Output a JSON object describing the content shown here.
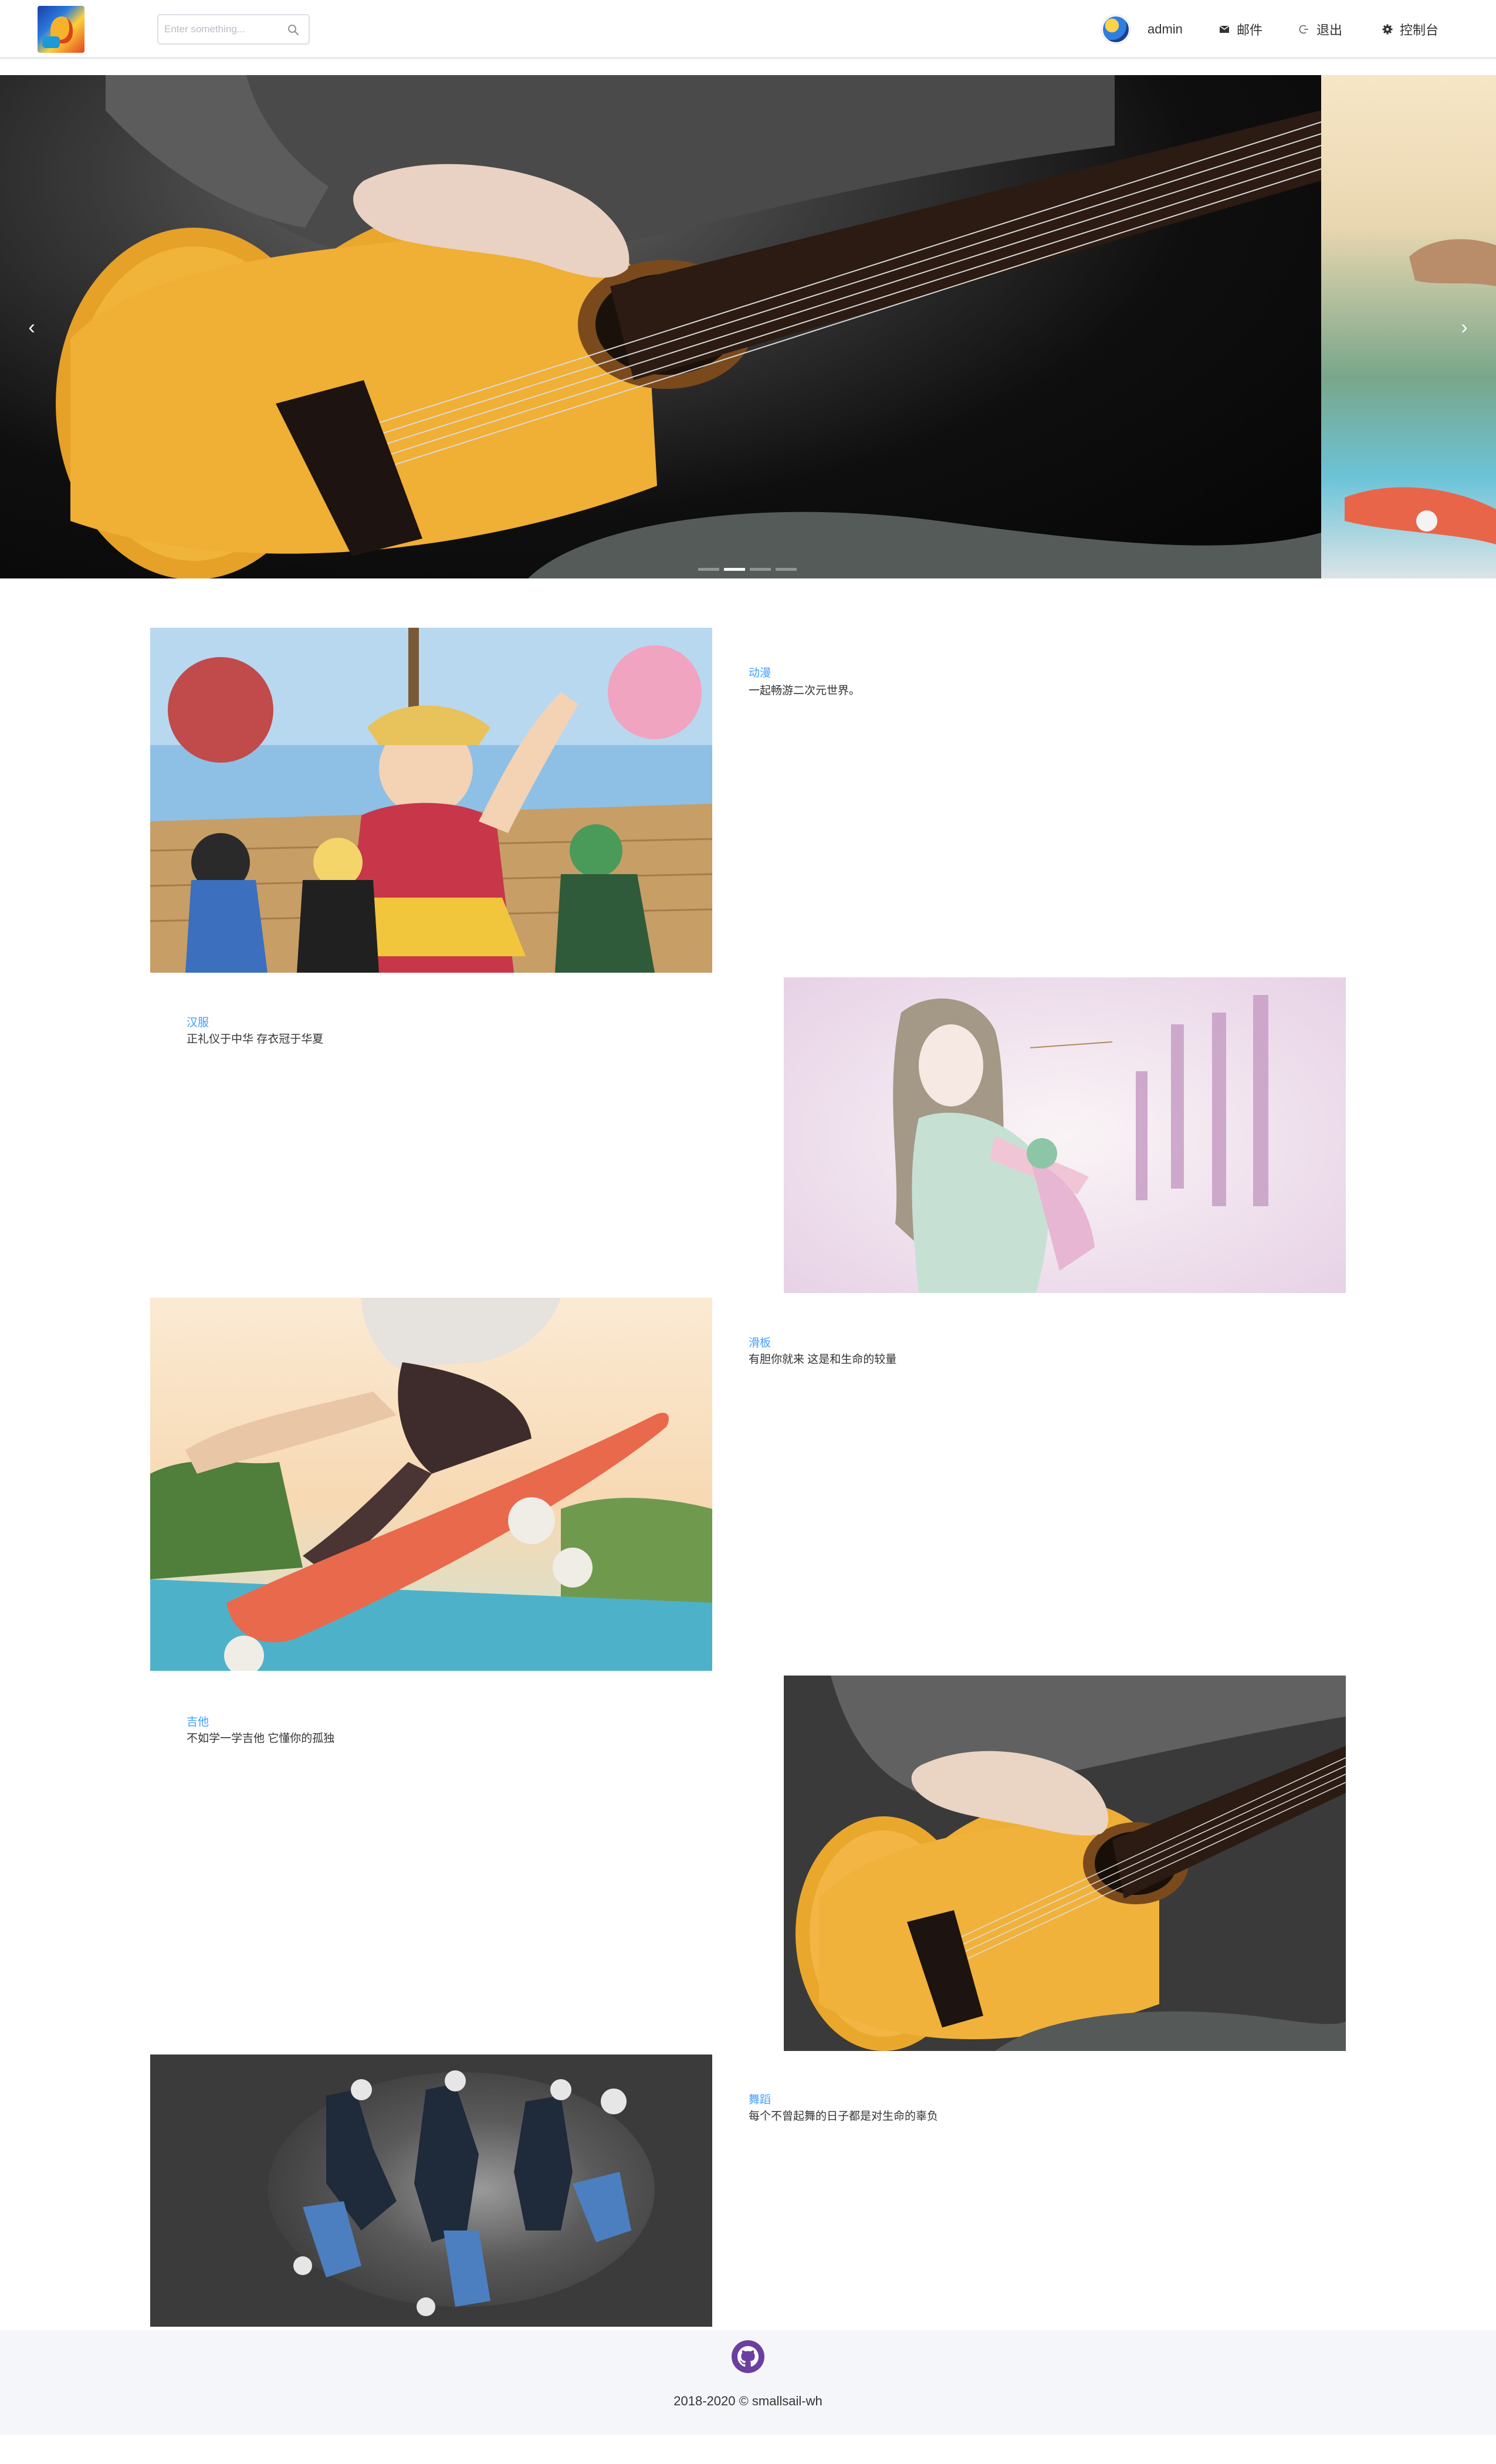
{
  "header": {
    "search_placeholder": "Enter something...",
    "username": "admin",
    "nav": [
      {
        "label": "邮件",
        "icon": "mail-icon"
      },
      {
        "label": "退出",
        "icon": "logout-icon"
      },
      {
        "label": "控制台",
        "icon": "gear-icon"
      }
    ]
  },
  "carousel": {
    "prev": "‹",
    "next": "›",
    "slide_count": 4,
    "active_index": 1
  },
  "cards": [
    {
      "title": "动漫",
      "desc": "一起畅游二次元世界。"
    },
    {
      "title": "汉服",
      "desc": "正礼仪于中华 存衣冠于华夏"
    },
    {
      "title": "滑板",
      "desc": "有胆你就来 这是和生命的较量"
    },
    {
      "title": "吉他",
      "desc": "不如学一学吉他 它懂你的孤独"
    },
    {
      "title": "舞蹈",
      "desc": "每个不曾起舞的日子都是对生命的辜负"
    }
  ],
  "footer": {
    "copyright": "2018-2020 © smallsail-wh",
    "icon": "github-icon"
  },
  "colors": {
    "accent": "#409eff",
    "text": "#333333",
    "footer_bg": "#f5f6f9"
  }
}
